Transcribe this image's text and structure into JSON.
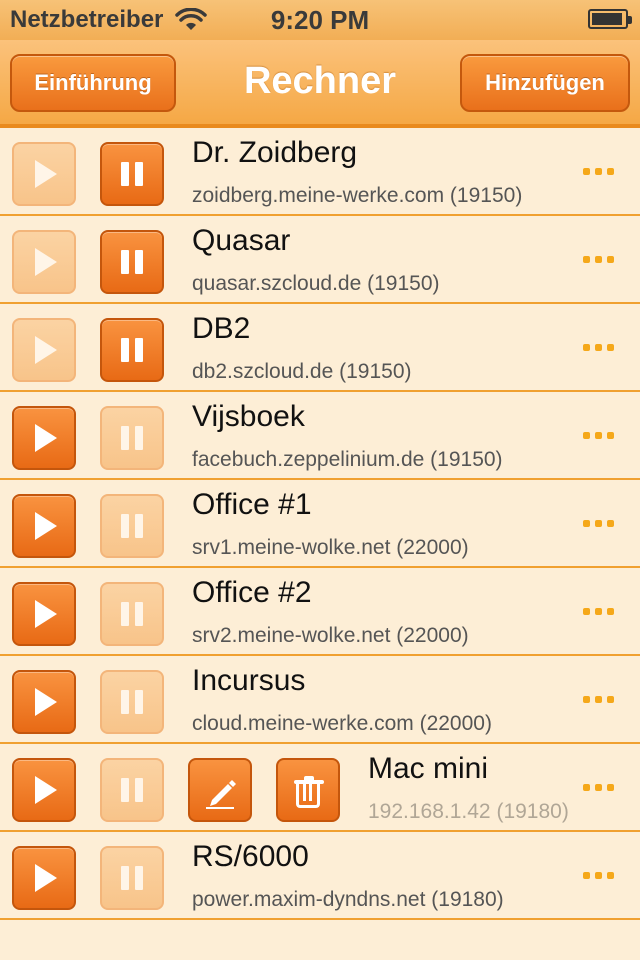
{
  "status_bar": {
    "carrier": "Netzbetreiber",
    "time": "9:20 PM",
    "battery_level": 0.95
  },
  "nav": {
    "title": "Rechner",
    "left_button": "Einführung",
    "right_button": "Hinzufügen"
  },
  "icons": {
    "play": "play-icon",
    "pause": "pause-icon",
    "more": "ellipsis-icon",
    "edit": "pencil-icon",
    "delete": "trash-icon"
  },
  "colors": {
    "accent": "#e86a15",
    "background": "#fdeed6",
    "dots": "#f5a81a"
  },
  "rows": [
    {
      "name": "Dr. Zoidberg",
      "host": "zoidberg.meine-werke.com (19150)",
      "running": true
    },
    {
      "name": "Quasar",
      "host": "quasar.szcloud.de (19150)",
      "running": true
    },
    {
      "name": "DB2",
      "host": "db2.szcloud.de (19150)",
      "running": true
    },
    {
      "name": "Vijsboek",
      "host": "facebuch.zeppelinium.de (19150)",
      "running": false
    },
    {
      "name": "Office #1",
      "host": "srv1.meine-wolke.net (22000)",
      "running": false
    },
    {
      "name": "Office #2",
      "host": "srv2.meine-wolke.net (22000)",
      "running": false
    },
    {
      "name": "Incursus",
      "host": "cloud.meine-werke.com (22000)",
      "running": false
    },
    {
      "name": "Mac mini",
      "host": "192.168.1.42 (19180)",
      "running": false,
      "editing": true
    },
    {
      "name": "RS/6000",
      "host": "power.maxim-dyndns.net (19180)",
      "running": false
    }
  ]
}
